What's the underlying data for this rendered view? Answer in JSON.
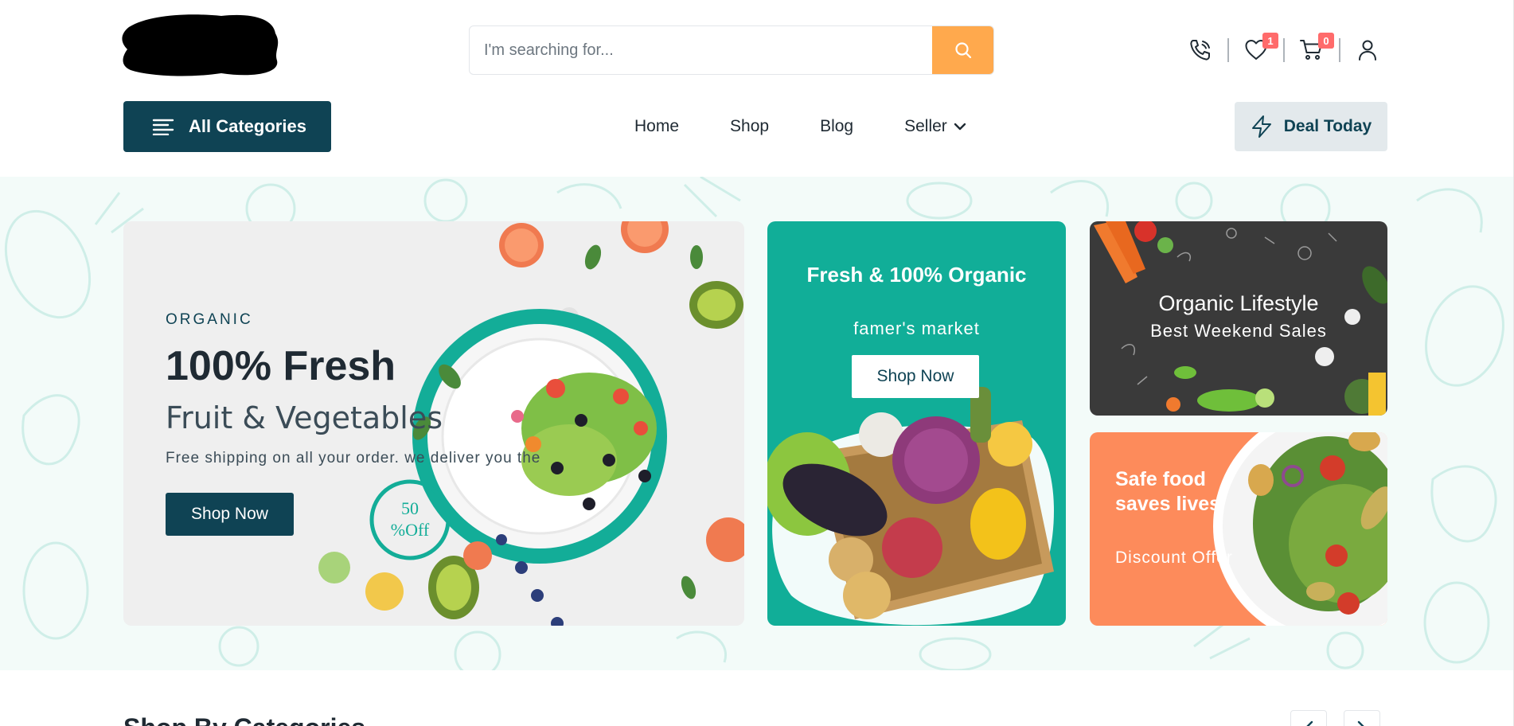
{
  "header": {
    "search": {
      "placeholder": "I'm searching for..."
    },
    "icons": {
      "phone": "phone-icon",
      "wishlist": "heart-icon",
      "cart": "cart-icon",
      "account": "user-icon",
      "search": "search-icon"
    },
    "wishlist_count": "1",
    "cart_count": "0"
  },
  "nav": {
    "all_categories": "All Categories",
    "items": [
      {
        "label": "Home"
      },
      {
        "label": "Shop"
      },
      {
        "label": "Blog"
      },
      {
        "label": "Seller"
      }
    ],
    "deal_today": "Deal Today"
  },
  "hero": {
    "main": {
      "kicker": "ORGANIC",
      "title": "100% Fresh",
      "subtitle": "Fruit & Vegetables",
      "description": "Free shipping on all your order. we deliver you the",
      "button": "Shop Now",
      "stamp": "50 %Off"
    },
    "teal": {
      "title": "Fresh & 100% Organic",
      "subtitle": "famer's market",
      "button": "Shop Now"
    },
    "dark": {
      "title": "Organic Lifestyle",
      "subtitle": "Best Weekend Sales"
    },
    "orange": {
      "title": "Safe food saves lives",
      "subtitle": "Discount Offer"
    }
  },
  "below": {
    "title": "Shop By Categories"
  },
  "colors": {
    "brand_dark": "#0f4354",
    "accent_orange": "#ffa94d",
    "teal": "#11ae98",
    "promo_orange": "#fd8b5b",
    "badge": "#ff6b6b"
  }
}
